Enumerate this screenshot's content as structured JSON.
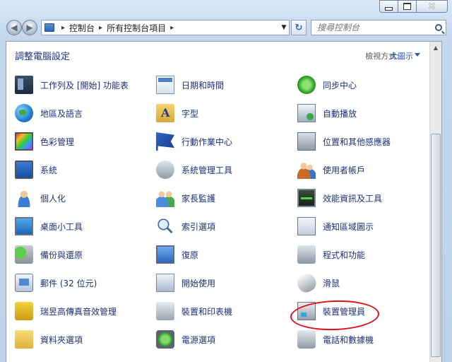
{
  "window": {
    "address_crumbs": [
      "控制台",
      "所有控制台項目"
    ],
    "search_placeholder": "搜尋控制台"
  },
  "content": {
    "title": "調整電腦設定",
    "view_by_label": "檢視方式:",
    "view_by_value": "大圖示"
  },
  "columns": [
    [
      {
        "label": "工作列及 [開始] 功能表",
        "icon": "taskbar-icon"
      },
      {
        "label": "地區及語言",
        "icon": "globe-icon"
      },
      {
        "label": "色彩管理",
        "icon": "color-management-icon"
      },
      {
        "label": "系統",
        "icon": "system-icon"
      },
      {
        "label": "個人化",
        "icon": "personalization-icon"
      },
      {
        "label": "桌面小工具",
        "icon": "desktop-gadgets-icon"
      },
      {
        "label": "備份與還原",
        "icon": "backup-icon"
      },
      {
        "label": "郵件 (32 位元)",
        "icon": "mail-icon"
      },
      {
        "label": "瑞昱高傳真音效管理",
        "icon": "audio-manager-icon"
      },
      {
        "label": "資料夾選項",
        "icon": "folder-options-icon"
      }
    ],
    [
      {
        "label": "日期和時間",
        "icon": "calendar-icon"
      },
      {
        "label": "字型",
        "icon": "font-icon"
      },
      {
        "label": "行動作業中心",
        "icon": "action-center-flag-icon"
      },
      {
        "label": "系統管理工具",
        "icon": "admin-tools-icon"
      },
      {
        "label": "家長監護",
        "icon": "parental-controls-icon"
      },
      {
        "label": "索引選項",
        "icon": "indexing-icon"
      },
      {
        "label": "復原",
        "icon": "recovery-icon"
      },
      {
        "label": "開始使用",
        "icon": "getting-started-icon"
      },
      {
        "label": "裝置和印表機",
        "icon": "devices-printers-icon"
      },
      {
        "label": "電源選項",
        "icon": "power-options-icon"
      }
    ],
    [
      {
        "label": "同步中心",
        "icon": "sync-center-icon"
      },
      {
        "label": "自動播放",
        "icon": "autoplay-icon"
      },
      {
        "label": "位置和其他感應器",
        "icon": "location-sensors-icon"
      },
      {
        "label": "使用者帳戶",
        "icon": "user-accounts-icon"
      },
      {
        "label": "效能資訊及工具",
        "icon": "performance-icon"
      },
      {
        "label": "通知區域圖示",
        "icon": "notification-area-icon"
      },
      {
        "label": "程式和功能",
        "icon": "programs-features-icon"
      },
      {
        "label": "滑鼠",
        "icon": "mouse-icon"
      },
      {
        "label": "裝置管理員",
        "icon": "device-manager-icon",
        "annotated": true
      },
      {
        "label": "電話和數據機",
        "icon": "phone-modem-icon"
      }
    ]
  ],
  "colors": {
    "link_text": "#1e2f76",
    "title_text": "#1e3287",
    "annotation": "#e0101a"
  }
}
